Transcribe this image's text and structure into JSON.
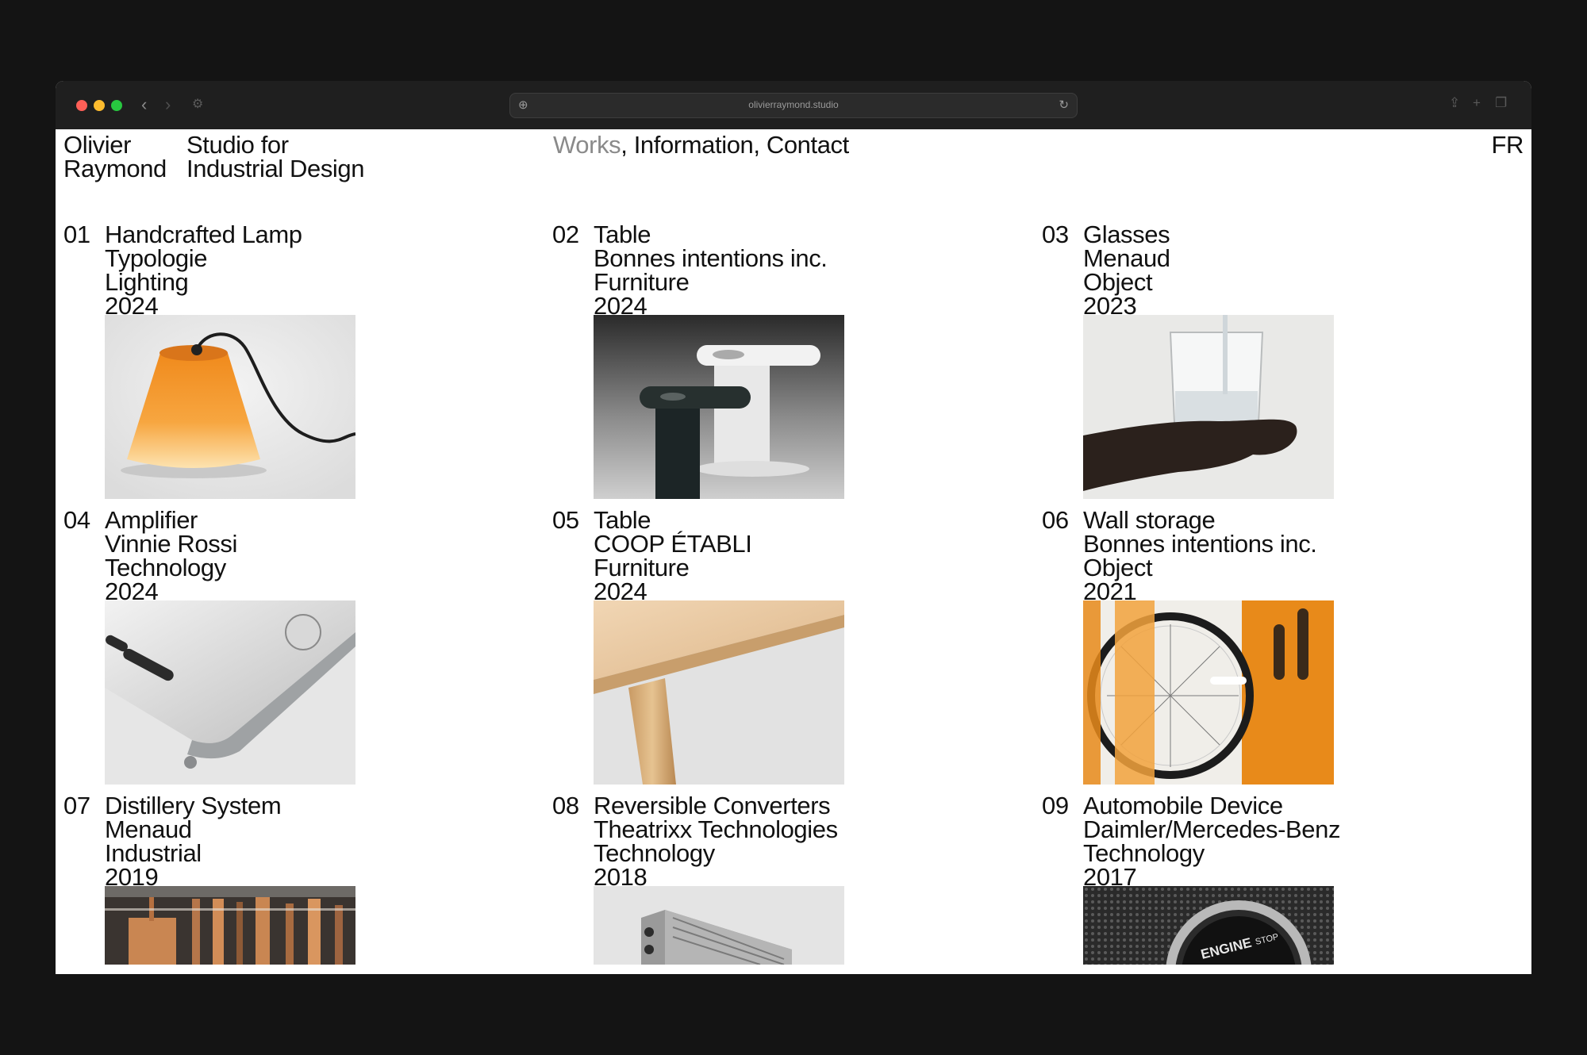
{
  "browser": {
    "url": "olivierraymond.studio",
    "back": "‹",
    "forward": "›",
    "site_icon": "⊕",
    "reload": "↻"
  },
  "header": {
    "name_line1": "Olivier",
    "name_line2": "Raymond",
    "tagline_line1": "Studio for",
    "tagline_line2": "Industrial Design",
    "nav_works": "Works",
    "nav_sep1": ", ",
    "nav_information": "Information",
    "nav_sep2": ", ",
    "nav_contact": "Contact",
    "lang": "FR"
  },
  "works": [
    {
      "num": "01",
      "title": "Handcrafted Lamp",
      "client": "Typologie",
      "category": "Lighting",
      "year": "2024"
    },
    {
      "num": "02",
      "title": "Table",
      "client": "Bonnes intentions inc.",
      "category": "Furniture",
      "year": "2024"
    },
    {
      "num": "03",
      "title": "Glasses",
      "client": "Menaud",
      "category": "Object",
      "year": "2023"
    },
    {
      "num": "04",
      "title": "Amplifier",
      "client": "Vinnie Rossi",
      "category": "Technology",
      "year": "2024"
    },
    {
      "num": "05",
      "title": "Table",
      "client": "COOP ÉTABLI",
      "category": "Furniture",
      "year": "2024"
    },
    {
      "num": "06",
      "title": "Wall storage",
      "client": "Bonnes intentions inc.",
      "category": "Object",
      "year": "2021"
    },
    {
      "num": "07",
      "title": "Distillery System",
      "client": "Menaud",
      "category": "Industrial",
      "year": "2019"
    },
    {
      "num": "08",
      "title": "Reversible Converters",
      "client": "Theatrixx Technologies",
      "category": "Technology",
      "year": "2018"
    },
    {
      "num": "09",
      "title": "Automobile Device",
      "client": "Daimler/Mercedes-Benz",
      "category": "Technology",
      "year": "2017"
    }
  ],
  "image_text": {
    "engine_button": "ENGINE",
    "engine_button_sub": "STOP"
  },
  "colors": {
    "page_bg": "#141414",
    "chrome_bg": "#1f1f1f",
    "accent_orange": "#e88a1a",
    "muted_text": "#8a8a8a"
  }
}
